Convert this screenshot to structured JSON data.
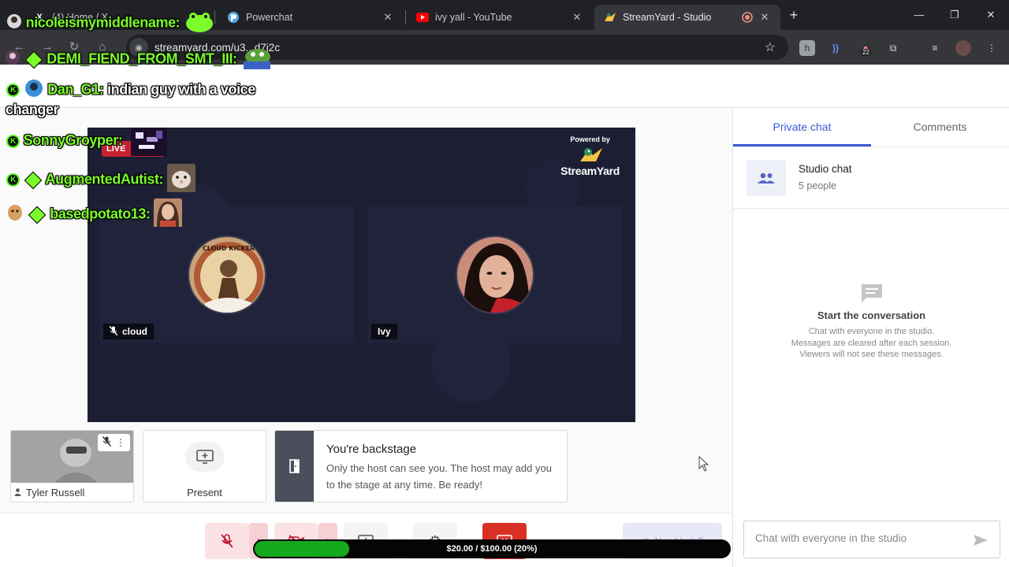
{
  "browser": {
    "tabs": [
      {
        "title": "(4) Home / X",
        "active": false
      },
      {
        "title": "Powerchat",
        "active": false
      },
      {
        "title": "ivy yall - YouTube",
        "active": false
      },
      {
        "title": "StreamYard - Studio",
        "active": true
      }
    ],
    "url": "streamyard.com/u3...d7j2c",
    "extension_badge": "22"
  },
  "stage": {
    "live_label": "LIVE",
    "powered_by": "Powered by",
    "brand": "StreamYard",
    "participants": [
      {
        "name": "cloud",
        "muted": true,
        "avatar_caption": "CLOUD KICKER"
      },
      {
        "name": "Ivy",
        "muted": false
      }
    ]
  },
  "self_card": {
    "name": "Tyler Russell"
  },
  "present_card": {
    "label": "Present"
  },
  "backstage": {
    "title": "You're backstage",
    "body": "Only the host can see you. The host may add you to the stage at any time. Be ready!"
  },
  "controls": {
    "help_label": "Need help?"
  },
  "donation": {
    "label": "$20.00 / $100.00 (20%)",
    "fraction": 0.2
  },
  "right_panel": {
    "tabs": [
      "Private chat",
      "Comments"
    ],
    "room": {
      "title": "Studio chat",
      "subtitle": "5 people"
    },
    "empty_title": "Start the conversation",
    "empty_lines": [
      "Chat with everyone in the studio.",
      "Messages are cleared after each session.",
      "Viewers will not see these messages."
    ],
    "input_placeholder": "Chat with everyone in the studio"
  },
  "chat_overlay": [
    {
      "user": "nicoleismymiddlename:",
      "message": ""
    },
    {
      "user": "DEMI_FIEND_FROM_SMT_III:",
      "message": ""
    },
    {
      "user": "Dan_G1:",
      "message": "indian guy with a voice",
      "message_cont": "changer"
    },
    {
      "user": "SonnyGroyper:",
      "message": ""
    },
    {
      "user": "AugmentedAutist:",
      "message": ""
    },
    {
      "user": "basedpotato13:",
      "message": ""
    }
  ],
  "colors": {
    "accent": "#3b5bd6",
    "live_red": "#c62033",
    "leave_red": "#d93025",
    "overlay_green": "#7cfc2a",
    "stage_bg": "#1c1e33"
  }
}
